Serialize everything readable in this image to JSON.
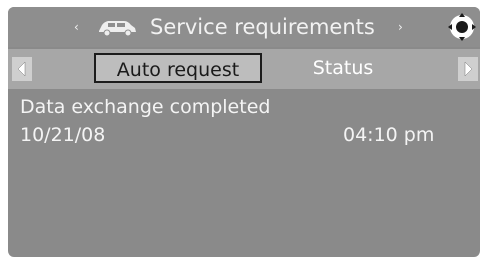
{
  "header": {
    "title": "Service requirements",
    "prev_arrow": "‹",
    "next_arrow": "›",
    "left_icon": "car-icon",
    "right_icon": "controller-icon"
  },
  "tabs": [
    {
      "label": "Auto request",
      "active": true
    },
    {
      "label": "Status",
      "active": false
    }
  ],
  "nav": {
    "left_icon": "scroll-left-icon",
    "right_icon": "scroll-right-icon"
  },
  "content": {
    "message": "Data exchange completed",
    "date": "10/21/08",
    "time": "04:10 pm"
  },
  "colors": {
    "screen_bg": "#8a8a8a",
    "tabbar_bg": "#a7a7a7",
    "active_tab_bg": "#bdbdbd",
    "text": "#f4f4f4"
  }
}
